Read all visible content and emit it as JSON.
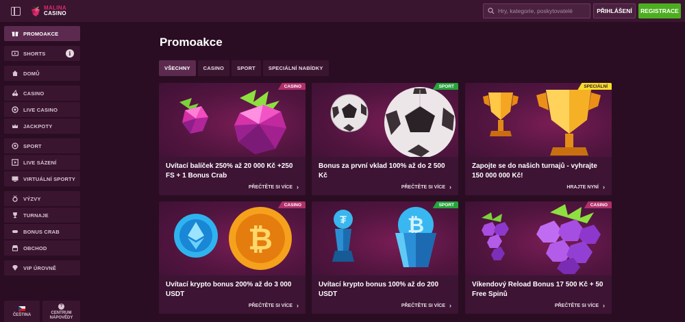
{
  "header": {
    "logo_line1": "MALINA",
    "logo_line2": "CASINO",
    "search_placeholder": "Hry, kategorie, poskytovatelé",
    "login_label": "PŘIHLÁŠENÍ",
    "register_label": "REGISTRACE"
  },
  "sidebar": {
    "items": [
      {
        "label": "PROMOAKCE",
        "icon": "gift-icon",
        "active": true
      },
      {
        "label": "SHORTS",
        "icon": "video-icon"
      },
      {
        "label": "DOMŮ",
        "icon": "home-icon"
      },
      {
        "label": "CASINO",
        "icon": "cherries-icon"
      },
      {
        "label": "LIVE CASINO",
        "icon": "chip-icon"
      },
      {
        "label": "JACKPOTY",
        "icon": "crown-icon"
      },
      {
        "label": "SPORT",
        "icon": "ball-icon"
      },
      {
        "label": "LIVE SÁZENÍ",
        "icon": "live-icon"
      },
      {
        "label": "VIRTUÁLNÍ SPORTY",
        "icon": "screen-icon"
      },
      {
        "label": "VÝZVY",
        "icon": "medal-icon"
      },
      {
        "label": "TURNAJE",
        "icon": "trophy-icon"
      },
      {
        "label": "BONUS CRAB",
        "icon": "claw-icon"
      },
      {
        "label": "OBCHOD",
        "icon": "shop-icon"
      },
      {
        "label": "VIP ÚROVNĚ",
        "icon": "diamond-icon"
      }
    ],
    "info_glyph": "i",
    "language_label": "ČEŠTINA",
    "help_line1": "CENTRUM",
    "help_line2": "NÁPOVĚDY"
  },
  "main": {
    "title": "Promoakce",
    "tabs": [
      {
        "label": "VŠECHNY",
        "active": true
      },
      {
        "label": "CASINO"
      },
      {
        "label": "SPORT"
      },
      {
        "label": "SPECIÁLNÍ NABÍDKY"
      }
    ],
    "cards": [
      {
        "badge": "CASINO",
        "title": "Uvítací balíček 250% až 20 000 Kč +250 FS + 1 Bonus Crab",
        "link": "PŘEČTĚTE SI VÍCE",
        "art": "raspberries"
      },
      {
        "badge": "SPORT",
        "title": "Bonus za první vklad 100% až do 2 500 Kč",
        "link": "PŘEČTĚTE SI VÍCE",
        "art": "soccer-balls"
      },
      {
        "badge": "SPECIÁLNÍ",
        "title": "Zapojte se do našich turnajů - vyhrajte 150 000 000 Kč!",
        "link": "HRAJTE NYNÍ",
        "art": "trophies"
      },
      {
        "badge": "CASINO",
        "title": "Uvítací krypto bonus 200% až do 3 000 USDT",
        "link": "PŘEČTĚTE SI VÍCE",
        "art": "crypto-coins"
      },
      {
        "badge": "SPORT",
        "title": "Uvítací krypto bonus 100% až do 200 USDT",
        "link": "PŘEČTĚTE SI VÍCE",
        "art": "crypto-trophies"
      },
      {
        "badge": "CASINO",
        "title": "Víkendový Reload Bonus 17 500 Kč + 50 Free Spinů",
        "link": "PŘEČTĚTE SI VÍCE",
        "art": "grapes"
      }
    ]
  },
  "colors": {
    "background": "#2a0d22",
    "panel": "#3a1530",
    "accent_green": "#4cae1f",
    "badge_casino": "#b0306a",
    "badge_sport": "#27a33b",
    "badge_special": "#f5dd2a"
  }
}
